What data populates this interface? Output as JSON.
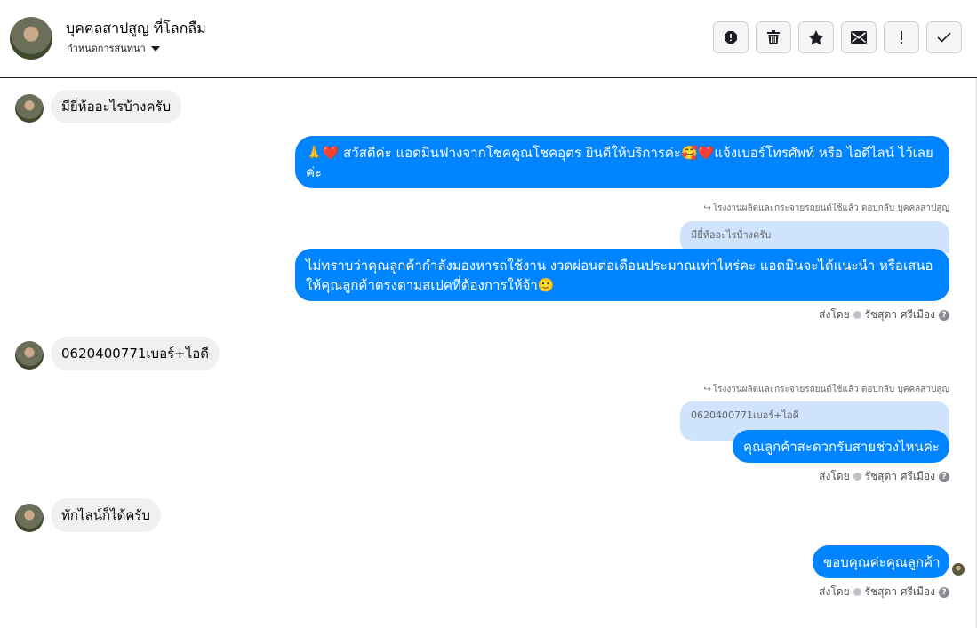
{
  "header": {
    "contact_name": "บุคคลสาปสูญ ที่โลกลืม",
    "assign_label": "กำหนดการสนทนา",
    "toolbar": [
      {
        "name": "report-spam-icon"
      },
      {
        "name": "trash-icon"
      },
      {
        "name": "star-icon"
      },
      {
        "name": "mail-icon"
      },
      {
        "name": "follow-up-icon"
      },
      {
        "name": "done-check-icon"
      }
    ]
  },
  "messages": {
    "in1": "มียี่ห้ออะไรบ้างครับ",
    "out1": "🙏❤️ สวัสดีค่ะ แอดมินฟางจากโชคคูณโชคอุตร ยินดีให้บริการค่ะ🥰❤️แจ้งเบอร์โทรศัพท์ หรือ ไอดีไลน์  ไว้เลยค่ะ",
    "reply_note1": "โรงงานผลิตและกระจายรถยนต์ใช้แล้ว ตอบกลับ บุคคลสาปสูญ",
    "quote1": "มียี่ห้ออะไรบ้างครับ",
    "out2": "ไม่ทราบว่าคุณลูกค้ากำลังมองหารถใช้งาน งวดผ่อนต่อเดือนประมาณเท่าไหร่คะ แอดมินจะได้แนะนำ หรือเสนอให้คุณลูกค้าตรงตามสเปคที่ต้องการให้จ้า🙂",
    "sent_by_label": "ส่งโดย",
    "sender_name": "รัชสุดา ศรีเมือง",
    "in2": "0620400771เบอร์+ไอดี",
    "reply_note2": "โรงงานผลิตและกระจายรถยนต์ใช้แล้ว ตอบกลับ บุคคลสาปสูญ",
    "quote2": "0620400771เบอร์+ไอดี",
    "out3": "คุณลูกค้าสะดวกรับสายช่วงไหนค่ะ",
    "in3": "ทักไลน์ก็ได้ครับ",
    "out4": "ขอบคุณค่ะคุณลูกค้า"
  },
  "colors": {
    "outgoing_bubble": "#0084ff",
    "incoming_bubble": "#f0f0f0",
    "quote_bubble": "#cfe3fc"
  }
}
